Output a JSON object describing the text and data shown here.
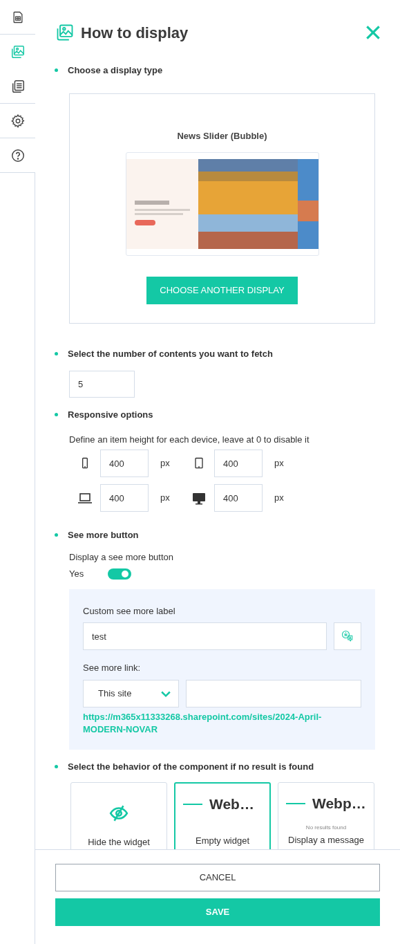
{
  "panel": {
    "title": "How to display"
  },
  "sidebar": {
    "items": [
      {
        "selected": false
      },
      {
        "selected": true
      },
      {
        "selected": false
      },
      {
        "selected": false
      },
      {
        "selected": false
      }
    ]
  },
  "display_type": {
    "heading": "Choose a display type",
    "name": "News Slider (Bubble)",
    "button": "CHOOSE ANOTHER DISPLAY"
  },
  "fetch": {
    "heading": "Select the number of contents you want to fetch",
    "value": "5"
  },
  "responsive": {
    "heading": "Responsive options",
    "description": "Define an item height for each device, leave at 0 to disable it",
    "devices": [
      {
        "kind": "phone",
        "value": "400",
        "unit": "px"
      },
      {
        "kind": "tablet",
        "value": "400",
        "unit": "px"
      },
      {
        "kind": "laptop",
        "value": "400",
        "unit": "px"
      },
      {
        "kind": "desktop",
        "value": "400",
        "unit": "px"
      }
    ]
  },
  "see_more": {
    "heading": "See more button",
    "toggle_label": "Display a see more button",
    "toggle": {
      "label": "Yes",
      "on": true
    },
    "custom_label": {
      "label": "Custom see more label",
      "value": "test"
    },
    "link": {
      "label": "See more link:",
      "select": "This site",
      "url": "https://m365x11333268.sharepoint.com/sites/2024-April-MODERN-NOVAR"
    }
  },
  "no_result": {
    "heading": "Select the behavior of the component if no result is found",
    "options": [
      {
        "kind": "hidden",
        "label": "Hide the widget",
        "selected": false
      },
      {
        "kind": "empty",
        "title": "Web…",
        "label": "Empty widget",
        "selected": true
      },
      {
        "kind": "message",
        "title": "Webp…",
        "message": "No results found",
        "label": "Display a message",
        "selected": false
      }
    ]
  },
  "footer": {
    "buttons": [
      {
        "kind": "secondary",
        "label": "CANCEL"
      },
      {
        "kind": "primary",
        "label": "SAVE"
      }
    ]
  }
}
